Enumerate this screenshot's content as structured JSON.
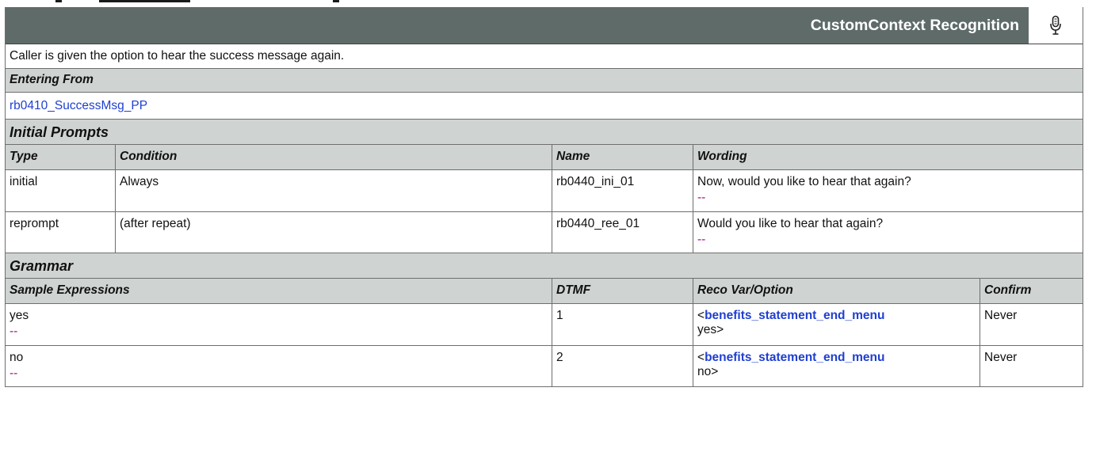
{
  "header": {
    "title": "CustomContext Recognition",
    "icon": "microphone-icon"
  },
  "description": "Caller is given the option to hear the success message again.",
  "entering_from": {
    "label": "Entering From",
    "link": "rb0410_SuccessMsg_PP"
  },
  "initial_prompts": {
    "label": "Initial Prompts",
    "columns": [
      "Type",
      "Condition",
      "Name",
      "Wording"
    ],
    "rows": [
      {
        "type": "initial",
        "condition": "Always",
        "name": "rb0440_ini_01",
        "wording": "Now, would you like to hear that again?",
        "note": "--"
      },
      {
        "type": "reprompt",
        "condition": "(after repeat)",
        "name": "rb0440_ree_01",
        "wording": "Would you like to hear that again?",
        "note": "--"
      }
    ]
  },
  "grammar": {
    "label": "Grammar",
    "columns": [
      "Sample Expressions",
      "DTMF",
      "Reco Var/Option",
      "Confirm"
    ],
    "rows": [
      {
        "expression": "yes",
        "note": "--",
        "dtmf": "1",
        "reco_prefix": "<",
        "reco_var": "benefits_statement_end_menu",
        "reco_value": "yes>",
        "confirm": "Never"
      },
      {
        "expression": "no",
        "note": "--",
        "dtmf": "2",
        "reco_prefix": "<",
        "reco_var": "benefits_statement_end_menu",
        "reco_value": "no>",
        "confirm": "Never"
      }
    ]
  }
}
